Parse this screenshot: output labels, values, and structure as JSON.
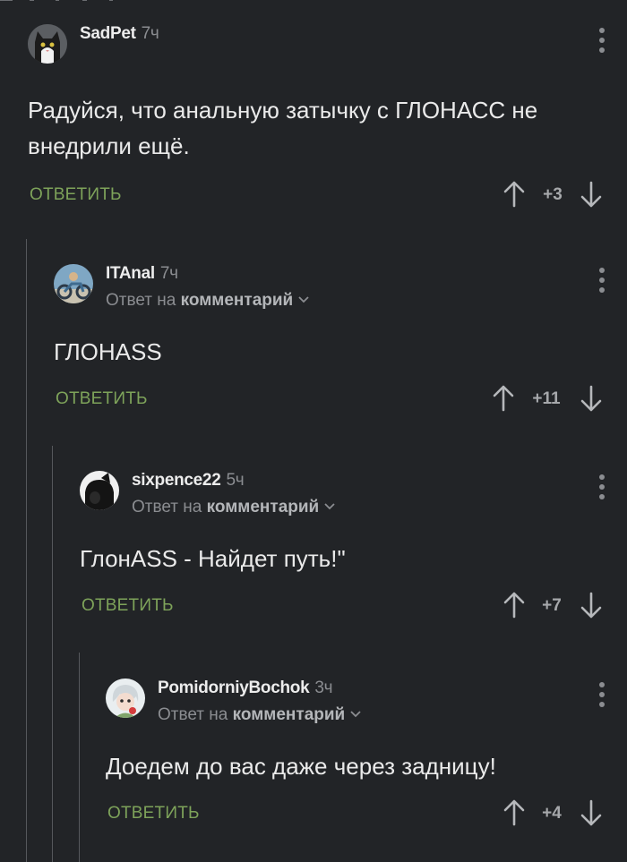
{
  "comments": [
    {
      "author": "SadPet",
      "time": "7ч",
      "text": "Радуйся, что анальную затычку с ГЛОНАСС не внедрили ещё.",
      "reply_label": "ОТВЕТИТЬ",
      "score": "+3"
    },
    {
      "author": "ITAnal",
      "time": "7ч",
      "reply_prefix": "Ответ на",
      "reply_target": "комментарий",
      "text": "ГЛОНАSS",
      "reply_label": "ОТВЕТИТЬ",
      "score": "+11"
    },
    {
      "author": "sixpence22",
      "time": "5ч",
      "reply_prefix": "Ответ на",
      "reply_target": "комментарий",
      "text": "ГлонASS - Найдет путь!\"",
      "reply_label": "ОТВЕТИТЬ",
      "score": "+7"
    },
    {
      "author": "PomidorniyBochok",
      "time": "3ч",
      "reply_prefix": "Ответ на",
      "reply_target": "комментарий",
      "text": "Доедем до вас даже через задницу!",
      "reply_label": "ОТВЕТИТЬ",
      "score": "+4"
    }
  ],
  "colors": {
    "background": "#222427",
    "reply_green": "#7ea35a",
    "muted": "#8b8d91",
    "thread_line": "#56585c"
  }
}
